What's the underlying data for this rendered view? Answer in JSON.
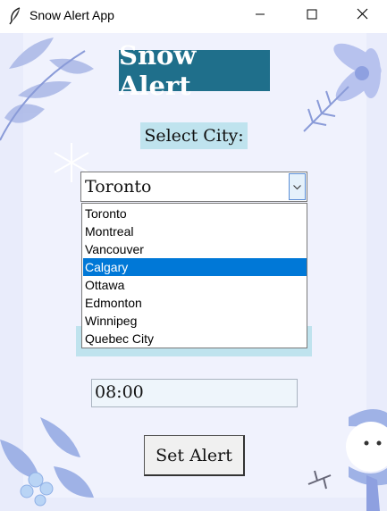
{
  "window": {
    "title": "Snow Alert App"
  },
  "app": {
    "heading": "Snow Alert",
    "select_label": "Select City:",
    "selected_city": "Toronto",
    "time_value": "08:00",
    "set_button_label": "Set Alert"
  },
  "dropdown": {
    "options": [
      "Toronto",
      "Montreal",
      "Vancouver",
      "Calgary",
      "Ottawa",
      "Edmonton",
      "Winnipeg",
      "Quebec City"
    ],
    "highlighted": "Calgary"
  },
  "colors": {
    "title_bg": "#1f6f8b",
    "label_bg": "#bfe3ee",
    "highlight": "#0078d7",
    "background": "#e9ecfb"
  },
  "icons": [
    "feather-icon",
    "minimize-icon",
    "maximize-icon",
    "close-icon",
    "chevron-down-icon"
  ]
}
